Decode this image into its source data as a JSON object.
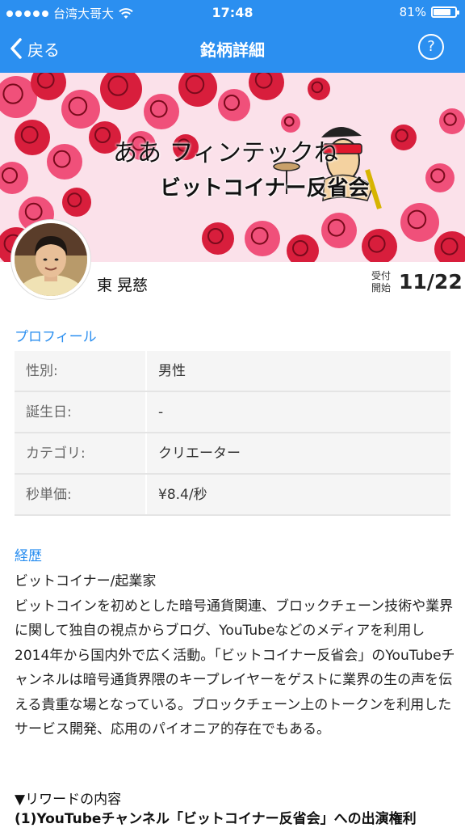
{
  "status_bar": {
    "carrier": "台湾大哥大",
    "time": "17:48",
    "battery_text": "81%",
    "battery_level": 0.81
  },
  "nav": {
    "back_label": "戻る",
    "title": "銘柄詳細",
    "help_label": "?"
  },
  "banner": {
    "line1": "ああ フィンテックね",
    "line2": "ビットコイナー反省会"
  },
  "person": {
    "name": "東 晃慈",
    "start_label_1": "受付",
    "start_label_2": "開始",
    "start_date": "11/22"
  },
  "profile": {
    "title": "プロフィール",
    "rows": [
      {
        "key": "性別:",
        "value": "男性"
      },
      {
        "key": "誕生日:",
        "value": "-"
      },
      {
        "key": "カテゴリ:",
        "value": "クリエーター"
      },
      {
        "key": "秒単価:",
        "value": "¥8.4/秒"
      }
    ]
  },
  "career": {
    "title": "経歴",
    "subtitle": "ビットコイナー/起業家",
    "body": "ビットコインを初めとした暗号通貨関連、ブロックチェーン技術や業界に関して独自の視点からブログ、YouTubeなどのメディアを利用し2014年から国内外で広く活動。「ビットコイナー反省会」のYouTubeチャンネルは暗号通貨界隈のキープレイヤーをゲストに業界の生の声を伝える貴重な場となっている。ブロックチェーン上のトークンを利用したサービス開発、応用のパイオニア的存在でもある。"
  },
  "reward": {
    "heading": "▼リワードの内容",
    "item1": "(1)YouTubeチャンネル「ビットコイナー反省会」への出演権利"
  },
  "colors": {
    "accent": "#2b8ff0",
    "banner_bg": "#fadbe6",
    "rose": "#d81e3c",
    "rose_pink": "#f0507a"
  }
}
